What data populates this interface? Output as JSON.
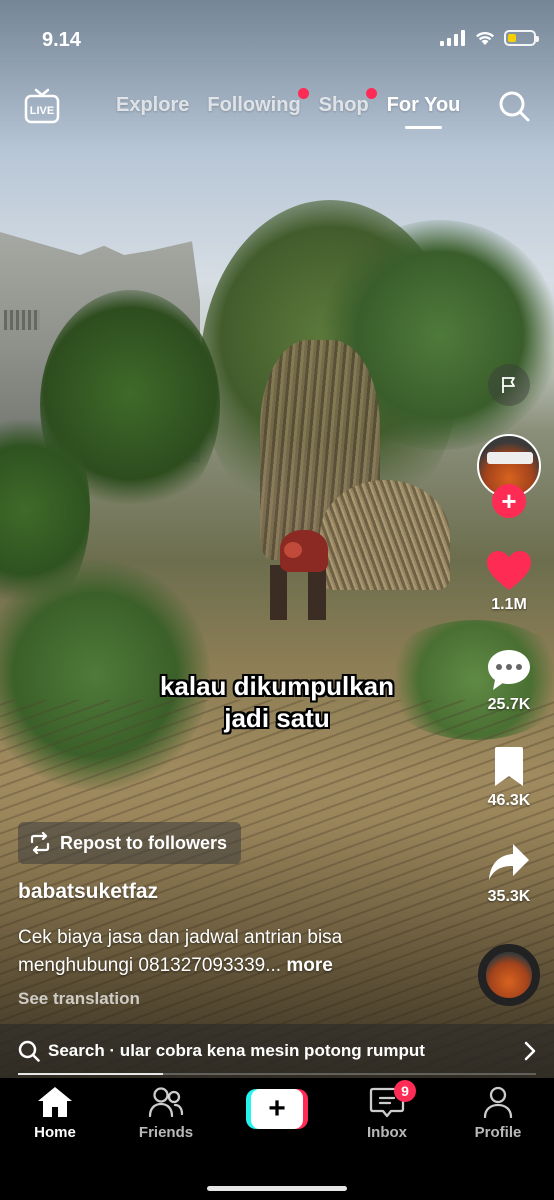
{
  "status_bar": {
    "time": "9.14",
    "battery_level": 0.35,
    "battery_color": "#f5d000"
  },
  "top_nav": {
    "tabs": [
      {
        "label": "Explore",
        "active": false,
        "dot": false
      },
      {
        "label": "Following",
        "active": false,
        "dot": true
      },
      {
        "label": "Shop",
        "active": false,
        "dot": true
      },
      {
        "label": "For You",
        "active": true,
        "dot": false
      }
    ],
    "live_icon": "live-tv-icon",
    "search_icon": "search-icon"
  },
  "video": {
    "subtitle_lines": [
      "kalau dikumpulkan",
      "jadi satu"
    ],
    "progress": 0.28
  },
  "actions": {
    "likes": "1.1M",
    "comments": "25.7K",
    "saves": "46.3K",
    "shares": "35.3K"
  },
  "info": {
    "repost_label": "Repost to followers",
    "username": "babatsuketfaz",
    "description": "Cek biaya jasa dan jadwal antrian bisa menghubungi 081327093339...",
    "more_label": "more",
    "see_translation": "See translation"
  },
  "search_suggestion": {
    "text": "Search · ular cobra kena mesin potong rumput"
  },
  "bottom_nav": {
    "home": "Home",
    "friends": "Friends",
    "inbox": "Inbox",
    "inbox_badge": "9",
    "profile": "Profile"
  },
  "colors": {
    "accent": "#fe2c55",
    "create_cyan": "#25f4ee",
    "like_red": "#fe2c55"
  }
}
